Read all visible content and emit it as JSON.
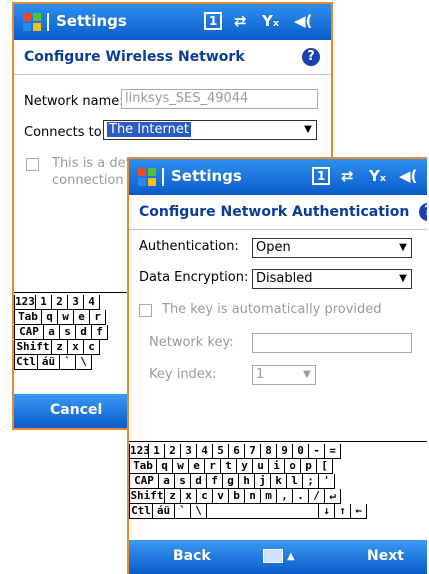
{
  "screen1": {
    "title": "Settings",
    "status_icons": [
      "1",
      "⇄",
      "Yₓ",
      "◀("
    ],
    "header": "Configure Wireless Network",
    "network_name_label": "Network name:",
    "network_name_value": "linksys_SES_49044",
    "connects_to_label": "Connects to:",
    "connects_to_value": "The Internet",
    "checkbox_text_1": "This is a devi",
    "checkbox_text_2": "connection",
    "keyboard_rows": [
      [
        "123",
        "1",
        "2",
        "3",
        "4"
      ],
      [
        "Tab",
        "q",
        "w",
        "e",
        "r"
      ],
      [
        "CAP",
        "a",
        "s",
        "d",
        "f"
      ],
      [
        "Shift",
        "z",
        "x",
        "c"
      ],
      [
        "Ctl",
        "áü",
        "`",
        "\\"
      ]
    ],
    "left_softkey": "Cancel"
  },
  "screen2": {
    "title": "Settings",
    "status_icons": [
      "1",
      "⇄",
      "Yₓ",
      "◀("
    ],
    "header": "Configure Network Authentication",
    "authentication_label": "Authentication:",
    "authentication_value": "Open",
    "data_encryption_label": "Data Encryption:",
    "data_encryption_value": "Disabled",
    "key_auto_label": "The key is automatically provided",
    "network_key_label": "Network key:",
    "network_key_value": "",
    "key_index_label": "Key index:",
    "key_index_value": "1",
    "keyboard_rows": [
      [
        "123",
        "1",
        "2",
        "3",
        "4",
        "5",
        "6",
        "7",
        "8",
        "9",
        "0",
        "-",
        "="
      ],
      [
        "Tab",
        "q",
        "w",
        "e",
        "r",
        "t",
        "y",
        "u",
        "i",
        "o",
        "p",
        "["
      ],
      [
        "CAP",
        "a",
        "s",
        "d",
        "f",
        "g",
        "h",
        "j",
        "k",
        "l",
        ";",
        "'"
      ],
      [
        "Shift",
        "z",
        "x",
        "c",
        "v",
        "b",
        "n",
        "m",
        ",",
        ".",
        "/",
        "↵"
      ],
      [
        "Ctl",
        "áü",
        "`",
        "\\",
        "",
        "",
        "",
        "",
        "",
        "↓",
        "↑",
        "←"
      ]
    ],
    "left_softkey": "Back",
    "right_softkey": "Next"
  },
  "colors": {
    "titlebar": "#0a5cc8",
    "header_text": "#0a3c9a",
    "frame": "#e8892c"
  }
}
